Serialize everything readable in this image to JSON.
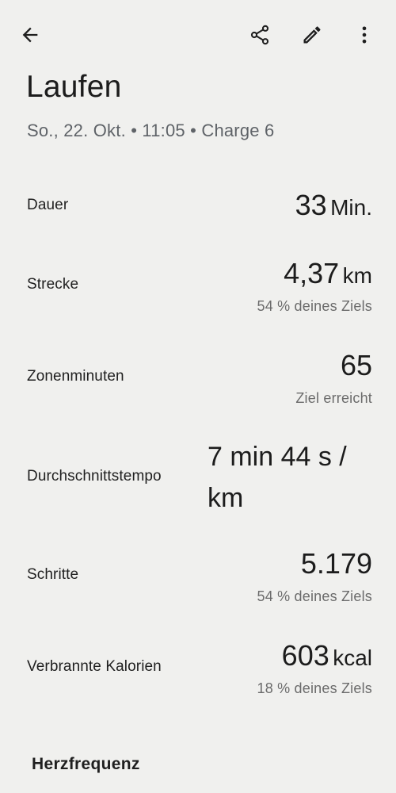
{
  "header": {
    "title": "Laufen",
    "subtitle": "So., 22. Okt. • 11:05 • Charge 6"
  },
  "icons": {
    "back": "arrow-back-icon",
    "share": "share-icon",
    "edit": "edit-pencil-icon",
    "more": "more-vert-icon"
  },
  "stats": {
    "duration": {
      "label": "Dauer",
      "value": "33",
      "unit": "Min."
    },
    "distance": {
      "label": "Strecke",
      "value": "4,37",
      "unit": "km",
      "goal": "54 % deines Ziels"
    },
    "zone_minutes": {
      "label": "Zonenminuten",
      "value": "65",
      "goal": "Ziel erreicht"
    },
    "pace": {
      "label": "Durchschnittstempo",
      "value": "7 min 44 s / km"
    },
    "steps": {
      "label": "Schritte",
      "value": "5.179",
      "goal": "54 % deines Ziels"
    },
    "calories": {
      "label": "Verbrannte Kalorien",
      "value": "603",
      "unit": "kcal",
      "goal": "18 % deines Ziels"
    }
  },
  "sections": {
    "heart_rate": "Herzfrequenz"
  },
  "colors": {
    "background": "#f0f0ee",
    "text_primary": "#1c1c1c",
    "text_secondary": "#5f6368"
  }
}
